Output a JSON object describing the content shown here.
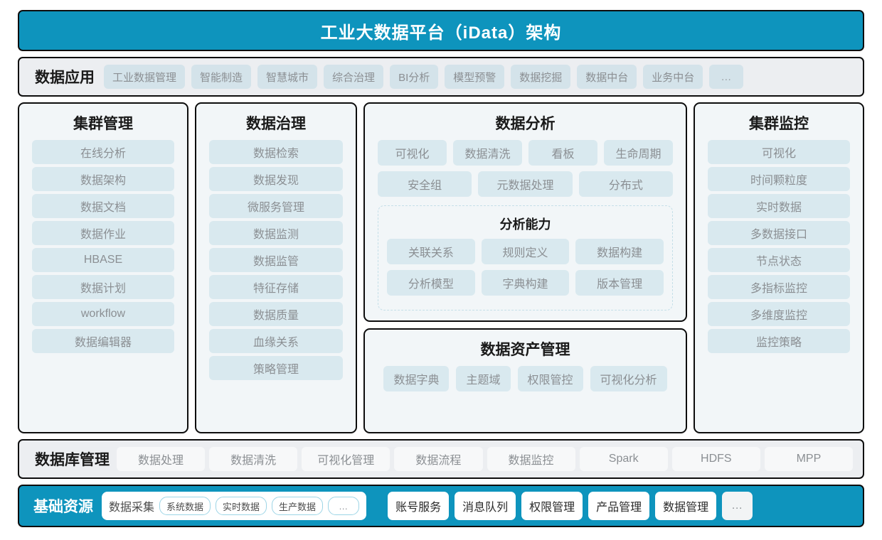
{
  "colors": {
    "brand_teal": "#0e94bd",
    "panel_bg": "#f2f6f8",
    "pill_blue": "#d9e9ef",
    "strip_gray": "#eceef1",
    "border_black": "#0d0d0d",
    "muted_text": "#8b8f93",
    "dashed_border": "#c5dfe8"
  },
  "header": {
    "title": "工业大数据平台（iData）架构"
  },
  "data_application": {
    "label": "数据应用",
    "items": [
      "工业数据管理",
      "智能制造",
      "智慧城市",
      "综合治理",
      "BI分析",
      "模型预警",
      "数据挖掘",
      "数据中台",
      "业务中台",
      "…"
    ]
  },
  "cluster_management": {
    "title": "集群管理",
    "items": [
      "在线分析",
      "数据架构",
      "数据文档",
      "数据作业",
      "HBASE",
      "数据计划",
      "workflow",
      "数据编辑器"
    ]
  },
  "data_governance": {
    "title": "数据治理",
    "items": [
      "数据检索",
      "数据发现",
      "微服务管理",
      "数据监测",
      "数据监管",
      "特征存储",
      "数据质量",
      "血缘关系",
      "策略管理"
    ]
  },
  "data_analysis": {
    "title": "数据分析",
    "row1": [
      "可视化",
      "数据清洗",
      "看板",
      "生命周期"
    ],
    "row2": [
      "安全组",
      "元数据处理",
      "分布式"
    ],
    "capability": {
      "title": "分析能力",
      "row1": [
        "关联关系",
        "规则定义",
        "数据构建"
      ],
      "row2": [
        "分析模型",
        "字典构建",
        "版本管理"
      ]
    }
  },
  "data_asset_management": {
    "title": "数据资产管理",
    "items": [
      "数据字典",
      "主题域",
      "权限管控",
      "可视化分析"
    ]
  },
  "cluster_monitoring": {
    "title": "集群监控",
    "items": [
      "可视化",
      "时间颗粒度",
      "实时数据",
      "多数据接口",
      "节点状态",
      "多指标监控",
      "多维度监控",
      "监控策略"
    ]
  },
  "database_management": {
    "label": "数据库管理",
    "items": [
      "数据处理",
      "数据清洗",
      "可视化管理",
      "数据流程",
      "数据监控",
      "Spark",
      "HDFS",
      "MPP"
    ]
  },
  "base_resource": {
    "label": "基础资源",
    "group": {
      "label": "数据采集",
      "sub_items": [
        "系统数据",
        "实时数据",
        "生产数据",
        "…"
      ]
    },
    "items": [
      "账号服务",
      "消息队列",
      "权限管理",
      "产品管理",
      "数据管理"
    ],
    "more": "…"
  }
}
